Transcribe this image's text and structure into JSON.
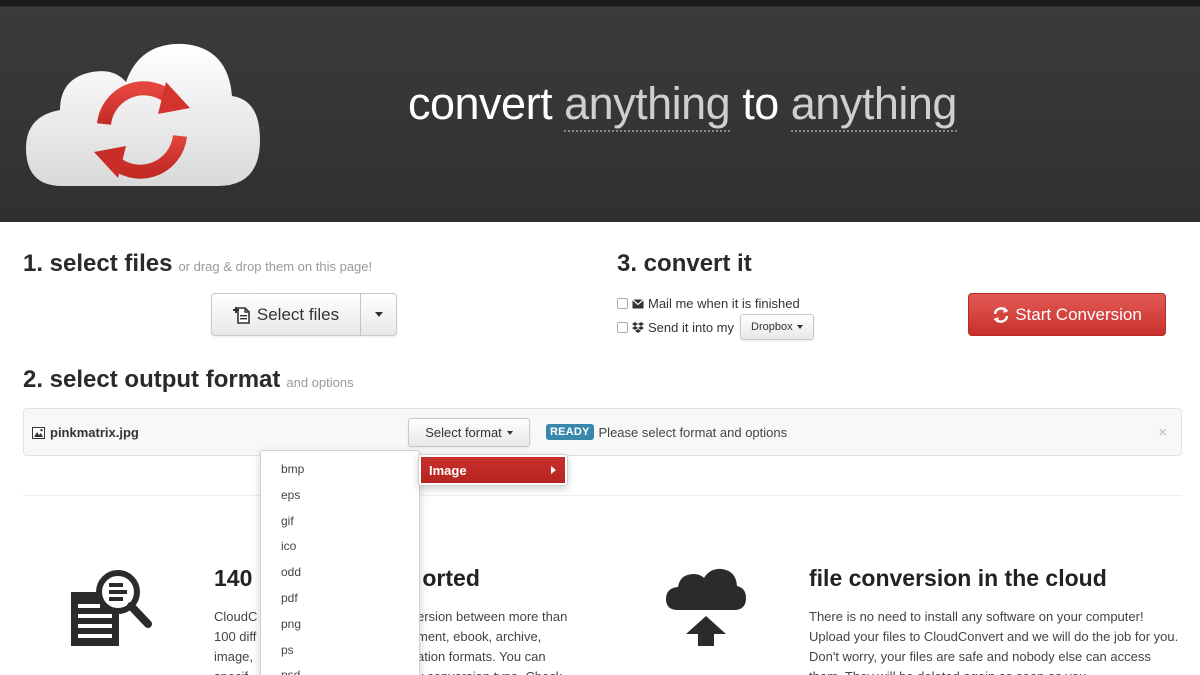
{
  "header": {
    "tagline_parts": [
      "convert ",
      "anything",
      " to ",
      "anything"
    ]
  },
  "step1": {
    "title": "1. select files",
    "hint": "or drag & drop them on this page!",
    "select_files_label": "Select files"
  },
  "step2": {
    "title": "2. select output format",
    "hint": "and options"
  },
  "step3": {
    "title": "3. convert it",
    "mail_label": "Mail me when it is finished",
    "send_label": "Send it into my",
    "dropbox_label": "Dropbox",
    "start_label": "Start Conversion"
  },
  "file_row": {
    "file_name": "pinkmatrix.jpg",
    "format_button": "Select format",
    "status_badge": "READY",
    "status_text": "Please select format and options",
    "close_symbol": "×"
  },
  "format_menu": {
    "items": [
      "bmp",
      "eps",
      "gif",
      "ico",
      "odd",
      "pdf",
      "png",
      "ps",
      "psd"
    ],
    "category": "Image"
  },
  "features": {
    "left_title": "140",
    "left_title_tail": "orted",
    "left_lines": [
      {
        "a": "CloudC",
        "b": "ersion between more than"
      },
      {
        "a": "100 diff",
        "b": "ment, ebook, archive,"
      },
      {
        "a": "image,",
        "b": "ation formats. You can"
      },
      {
        "a": "specif",
        "b": "y conversion type. Check"
      }
    ],
    "right_title": "file conversion in the cloud",
    "right_text": "There is no need to install any software on your computer! Upload your files to CloudConvert and we will do the job for you. Don't worry, your files are safe and nobody else can access them. They will be deleted again as soon as you"
  },
  "colors": {
    "header_bg": "#303030",
    "accent_red": "#c9302c",
    "ready_badge": "#3a87ad"
  }
}
